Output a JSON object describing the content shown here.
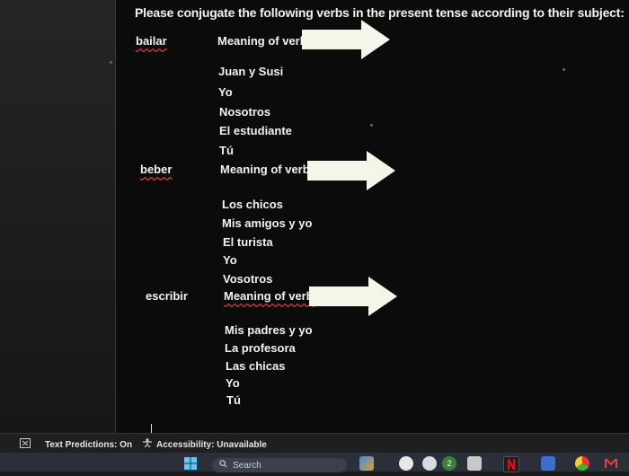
{
  "instructions": "Please conjugate the following verbs in the present tense according to their subject:",
  "sections": [
    {
      "verb": "bailar",
      "meaning_label": "Meaning of verb:",
      "subjects": [
        "Juan y Susi",
        "Yo",
        "Nosotros",
        "El estudiante",
        "Tú"
      ]
    },
    {
      "verb": "beber",
      "meaning_label": "Meaning of verb:",
      "subjects": [
        "Los chicos",
        "Mis amigos y yo",
        "El turista",
        "Yo",
        "Vosotros"
      ]
    },
    {
      "verb": "escribir",
      "meaning_label": "Meaning of verb:",
      "subjects": [
        "Mis padres y yo",
        "La profesora",
        "Las chicas",
        "Yo",
        "Tú"
      ]
    }
  ],
  "statusbar": {
    "text_predictions": "Text Predictions: On",
    "accessibility": "Accessibility: Unavailable"
  },
  "taskbar": {
    "search_placeholder": "Search",
    "badge_count": "2"
  },
  "colors": {
    "arrow_fill": "#f4f6ea",
    "spell_underline": "#d83a3a",
    "document_bg": "#0b0b0b"
  }
}
